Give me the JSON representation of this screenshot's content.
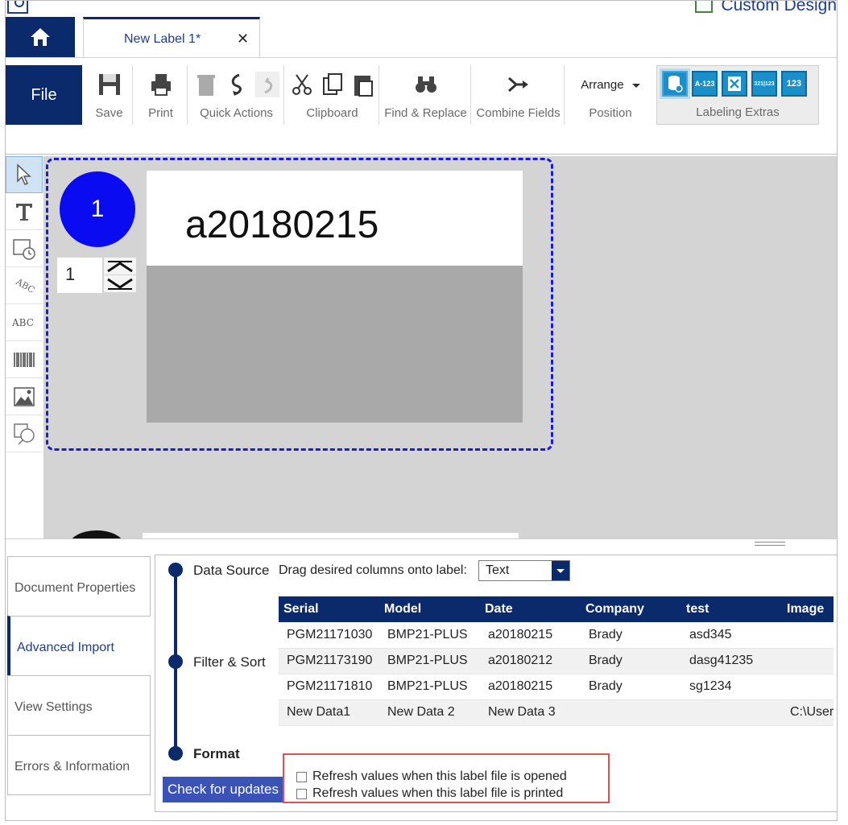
{
  "header": {
    "app_title": "Custom Design",
    "doc_tab_label": "New Label 1*",
    "doc_tab_close": "✕"
  },
  "ribbon": {
    "file_label": "File",
    "groups": {
      "save": "Save",
      "print": "Print",
      "quick_actions": "Quick Actions",
      "clipboard": "Clipboard",
      "find_replace": "Find & Replace",
      "combine_fields": "Combine Fields",
      "position": "Position",
      "arrange": "Arrange",
      "labeling_extras": "Labeling Extras"
    },
    "labeling_extras_icons": [
      "database-icon",
      "A-123",
      "excel-icon",
      "321|123",
      "123"
    ]
  },
  "canvas": {
    "label_number": "1",
    "record_value": "1",
    "label_text": "a20180215"
  },
  "side_tabs": [
    "Document Properties",
    "Advanced Import",
    "View Settings",
    "Errors & Information"
  ],
  "active_side_tab": "Advanced Import",
  "import": {
    "steps": {
      "data_source": "Data Source",
      "filter_sort": "Filter & Sort",
      "format": "Format"
    },
    "drag_label": "Drag desired columns onto label:",
    "select_value": "Text",
    "columns": [
      "Serial",
      "Model",
      "Date",
      "Company",
      "test",
      "Image"
    ],
    "rows": [
      [
        "PGM21171030",
        "BMP21-PLUS",
        "a20180215",
        "Brady",
        "asd345",
        ""
      ],
      [
        "PGM21173190",
        "BMP21-PLUS",
        "a20180212",
        "Brady",
        "dasg41235",
        ""
      ],
      [
        "PGM21171810",
        "BMP21-PLUS",
        "a20180215",
        "Brady",
        "sg1234",
        ""
      ],
      [
        "New Data1",
        "New Data 2",
        "New Data 3",
        "",
        "",
        "C:\\User"
      ]
    ],
    "check_updates": "Check for updates",
    "refresh_opened": "Refresh values when this label file is opened",
    "refresh_printed": "Refresh values when this label file is printed"
  },
  "colors": {
    "brand_navy": "#0b2a6b",
    "label_circle": "#0b0bf2",
    "labeling_extras": "#1a8fc9",
    "highlight_box": "#e05050"
  }
}
